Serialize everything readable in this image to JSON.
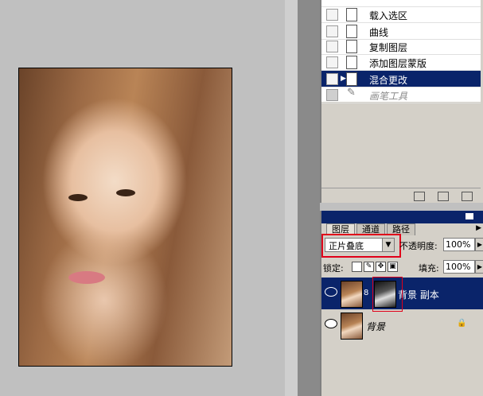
{
  "history": {
    "items": [
      {
        "label": "载入选区",
        "state": "normal"
      },
      {
        "label": "曲线",
        "state": "normal"
      },
      {
        "label": "复制图层",
        "state": "normal"
      },
      {
        "label": "添加图层蒙版",
        "state": "normal"
      },
      {
        "label": "混合更改",
        "state": "selected"
      },
      {
        "label": "画笔工具",
        "state": "disabled"
      }
    ]
  },
  "layers": {
    "tabs": [
      "图层",
      "通道",
      "路径"
    ],
    "blend_mode": "正片叠底",
    "opacity_label": "不透明度:",
    "opacity_value": "100%",
    "lock_label": "锁定:",
    "fill_label": "填充:",
    "fill_value": "100%",
    "items": [
      {
        "name": "背景 副本",
        "selected": true,
        "has_mask": true
      },
      {
        "name": "背景",
        "selected": false,
        "locked": true
      }
    ]
  },
  "colors": {
    "selection": "#0a246a",
    "highlight_box": "#e0001a",
    "panel_bg": "#d4d0c8"
  },
  "icons": [
    "document-icon",
    "brush-icon",
    "eye-icon",
    "lock-icon",
    "chain-link-icon",
    "dropdown-arrow-icon",
    "new-snapshot-icon",
    "new-document-icon",
    "trash-icon"
  ]
}
